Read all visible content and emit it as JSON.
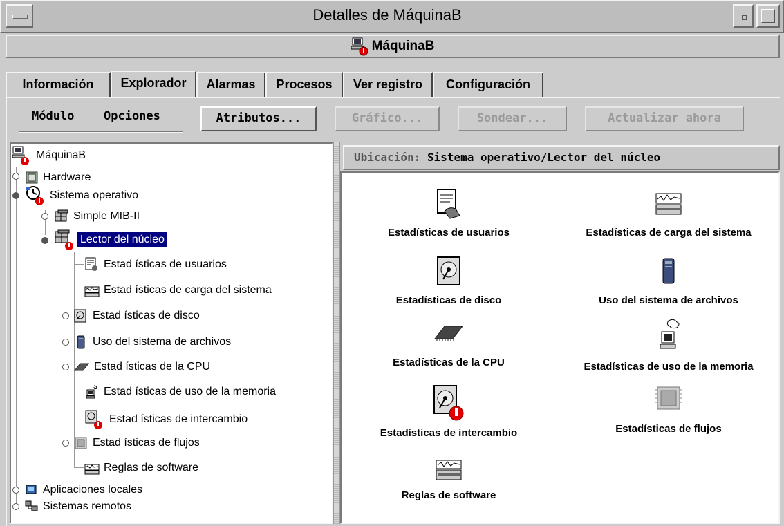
{
  "window": {
    "title": "Detalles de MáquinaB"
  },
  "host": {
    "name": "MáquinaB"
  },
  "tabs": [
    {
      "label": "Información",
      "active": false
    },
    {
      "label": "Explorador",
      "active": true
    },
    {
      "label": "Alarmas",
      "active": false
    },
    {
      "label": "Procesos",
      "active": false
    },
    {
      "label": "Ver registro",
      "active": false
    },
    {
      "label": "Configuración",
      "active": false
    }
  ],
  "toolbar": {
    "menus": [
      "Módulo",
      "Opciones"
    ],
    "buttons": [
      {
        "label": "Atributos...",
        "enabled": true
      },
      {
        "label": "Gráfico...",
        "enabled": false
      },
      {
        "label": "Sondear...",
        "enabled": false
      },
      {
        "label": "Actualizar ahora",
        "enabled": false
      }
    ]
  },
  "tree": [
    {
      "label": "MáquinaB",
      "icon": "host-icon",
      "alarm": true
    },
    {
      "label": "Hardware",
      "icon": "hardware-icon"
    },
    {
      "label": "Sistema operativo",
      "icon": "os-icon",
      "alarm": true
    },
    {
      "label": "Simple MIB-II",
      "icon": "module-icon"
    },
    {
      "label": "Lector del núcleo",
      "icon": "module-icon",
      "alarm": true,
      "selected": true
    },
    {
      "label": "Estad ísticas de usuarios",
      "icon": "user-stats-icon"
    },
    {
      "label": "Estad ísticas de carga del sistema",
      "icon": "load-stats-icon"
    },
    {
      "label": "Estad ísticas de disco",
      "icon": "disk-icon"
    },
    {
      "label": "Uso del sistema de archivos",
      "icon": "filesystem-icon"
    },
    {
      "label": "Estad ísticas de la CPU",
      "icon": "cpu-icon"
    },
    {
      "label": "Estad ísticas de uso de la memoria",
      "icon": "memory-icon"
    },
    {
      "label": "Estad ísticas de intercambio",
      "icon": "swap-icon",
      "alarm": true
    },
    {
      "label": "Estad ísticas de flujos",
      "icon": "streams-icon"
    },
    {
      "label": "Reglas de software",
      "icon": "rules-icon"
    },
    {
      "label": "Aplicaciones locales",
      "icon": "apps-icon"
    },
    {
      "label": "Sistemas remotos",
      "icon": "remote-icon"
    }
  ],
  "location": {
    "prefix": "Ubicación:",
    "path": "Sistema operativo/Lector del núcleo"
  },
  "icons": [
    {
      "label": "Estadísticas de usuarios",
      "icon": "user-stats-icon"
    },
    {
      "label": "Estadísticas de carga del sistema",
      "icon": "load-stats-icon"
    },
    {
      "label": "Estadísticas de disco",
      "icon": "disk-icon"
    },
    {
      "label": "Uso del sistema de archivos",
      "icon": "filesystem-icon"
    },
    {
      "label": "Estadísticas de la CPU",
      "icon": "cpu-icon"
    },
    {
      "label": "Estadísticas de uso de la memoria",
      "icon": "memory-icon"
    },
    {
      "label": "Estadísticas de intercambio",
      "icon": "swap-icon",
      "alarm": true
    },
    {
      "label": "Estadísticas de flujos",
      "icon": "streams-icon"
    },
    {
      "label": "Reglas de software",
      "icon": "rules-icon"
    }
  ],
  "colors": {
    "selection": "#000080",
    "alarm": "#e00000",
    "panel": "#cccccc"
  }
}
